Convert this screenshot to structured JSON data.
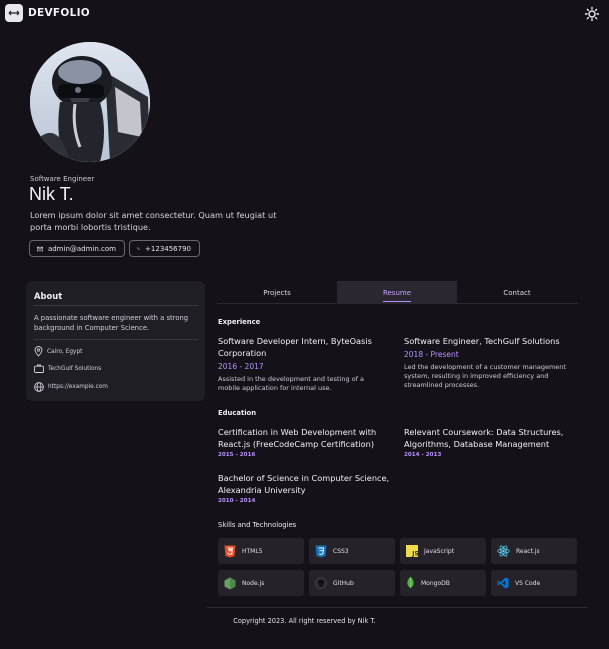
{
  "header": {
    "logo_text": "DEVFOLIO",
    "logo_icon": "arrows-icon",
    "theme_icon": "sun-icon"
  },
  "profile": {
    "role": "Software Engineer",
    "name": "Nik T.",
    "bio": "Lorem ipsum dolor sit amet consectetur. Quam ut feugiat ut porta morbi lobortis tristique.",
    "email": "admin@admin.com",
    "phone": "+123456790"
  },
  "about": {
    "title": "About",
    "text": "A passionate software engineer with a strong background in Computer Science.",
    "location": "Cairo, Egypt",
    "company": "TechGulf Solutions",
    "website": "https://example.com"
  },
  "tabs": [
    {
      "label": "Projects"
    },
    {
      "label": "Resume"
    },
    {
      "label": "Contact"
    }
  ],
  "resume": {
    "experience_title": "Experience",
    "experience": [
      {
        "title": "Software Developer Intern, ByteOasis Corporation",
        "date": "2016 - 2017",
        "desc": "Assisted in the development and testing of a mobile application for internal use."
      },
      {
        "title": "Software Engineer, TechGulf Solutions",
        "date": "2018 - Present",
        "desc": "Led the development of a customer management system, resulting in improved efficiency and streamlined processes."
      }
    ],
    "education_title": "Education",
    "education": [
      {
        "title": "Certification in Web Development with React.js (FreeCodeCamp Certification)",
        "date": "2015 - 2016"
      },
      {
        "title": "Relevant Coursework: Data Structures, Algorithms, Database Management",
        "date": "2014 - 2013"
      },
      {
        "title": "Bachelor of Science in Computer Science, Alexandria University",
        "date": "2010 - 2014"
      }
    ],
    "skills_title": "Skills and Technologies",
    "skills": [
      {
        "name": "HTML5",
        "icon": "html5-icon",
        "color": "#e44d26"
      },
      {
        "name": "CSS3",
        "icon": "css3-icon",
        "color": "#1572b6"
      },
      {
        "name": "JavaScript",
        "icon": "javascript-icon",
        "color": "#f0db4f"
      },
      {
        "name": "React.js",
        "icon": "react-icon",
        "color": "#61dafb"
      },
      {
        "name": "Node.js",
        "icon": "nodejs-icon",
        "color": "#68a063"
      },
      {
        "name": "GitHub",
        "icon": "github-icon",
        "color": "#2d2b31"
      },
      {
        "name": "MongoDB",
        "icon": "mongodb-icon",
        "color": "#4db33d"
      },
      {
        "name": "VS Code",
        "icon": "vscode-icon",
        "color": "#0078d7"
      }
    ]
  },
  "footer": {
    "copyright": "Copyright 2023. All right reserved by Nik T."
  },
  "colors": {
    "background": "#141218",
    "accent": "#b68cff",
    "card": "#201e25"
  }
}
